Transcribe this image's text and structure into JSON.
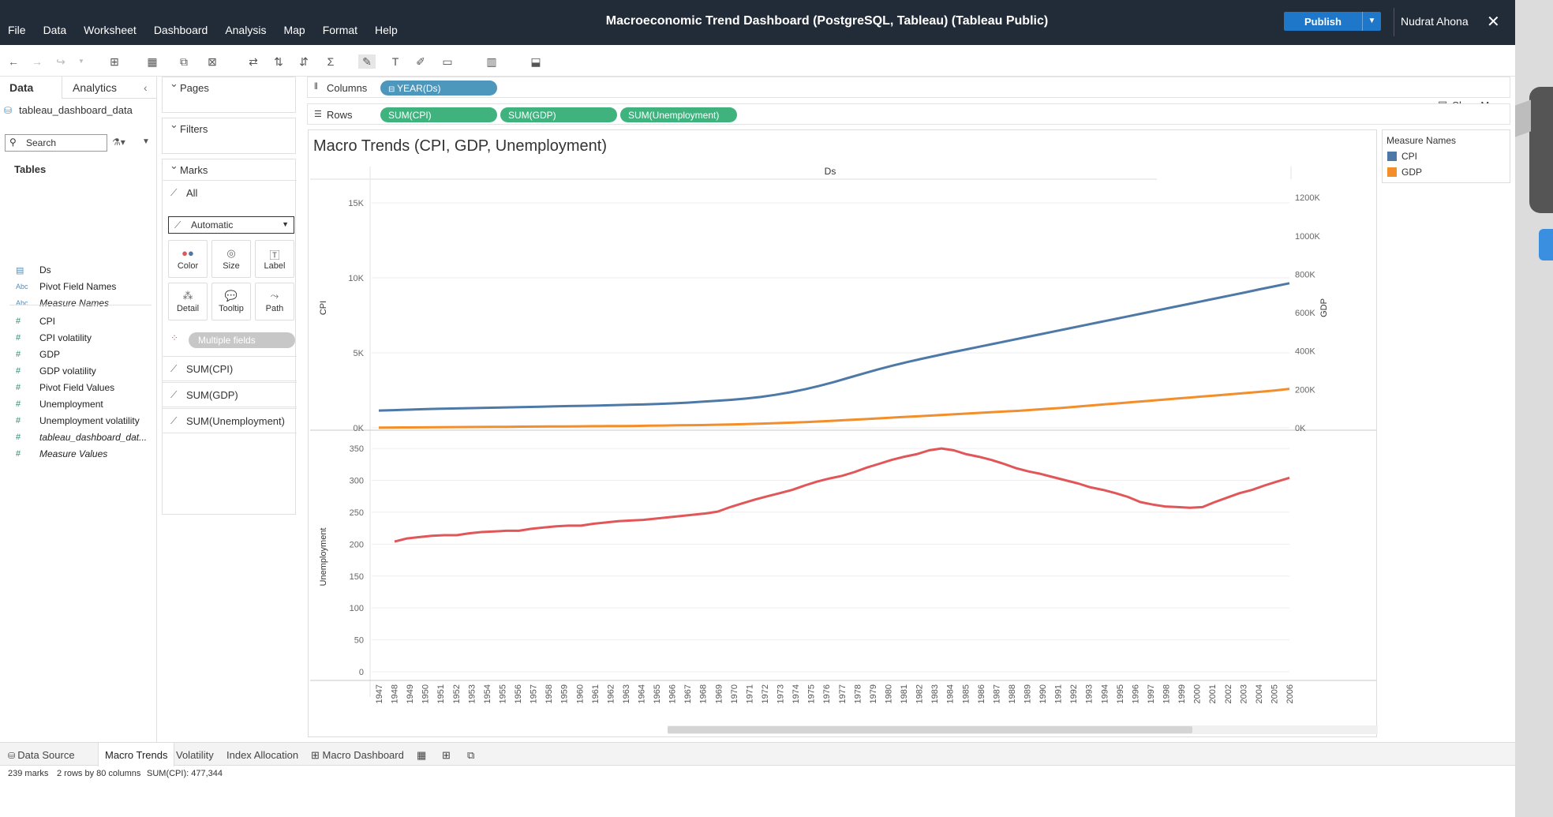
{
  "window": {
    "title": "Macroeconomic Trend Dashboard (PostgreSQL, Tableau) (Tableau Public)",
    "menu": [
      "File",
      "Data",
      "Worksheet",
      "Dashboard",
      "Analysis",
      "Map",
      "Format",
      "Help"
    ],
    "publish_label": "Publish",
    "user": "Nudrat Ahona"
  },
  "toolbar": {
    "show_me": "Show Me"
  },
  "data_pane": {
    "tabs": [
      "Data",
      "Analytics"
    ],
    "datasource": "tableau_dashboard_data",
    "search_placeholder": "Search",
    "tables_header": "Tables",
    "fields": [
      {
        "name": "Ds",
        "type": "date",
        "italic": false
      },
      {
        "name": "Pivot Field Names",
        "type": "abc",
        "italic": false
      },
      {
        "name": "Measure Names",
        "type": "abc",
        "italic": true
      },
      {
        "name": "CPI",
        "type": "num",
        "italic": false
      },
      {
        "name": "CPI volatility",
        "type": "num",
        "italic": false
      },
      {
        "name": "GDP",
        "type": "num",
        "italic": false
      },
      {
        "name": "GDP volatility",
        "type": "num",
        "italic": false
      },
      {
        "name": "Pivot Field Values",
        "type": "num",
        "italic": false
      },
      {
        "name": "Unemployment",
        "type": "num",
        "italic": false
      },
      {
        "name": "Unemployment volatility",
        "type": "num",
        "italic": false
      },
      {
        "name": "tableau_dashboard_dat...",
        "type": "num",
        "italic": true
      },
      {
        "name": "Measure Values",
        "type": "num",
        "italic": true
      }
    ]
  },
  "cards": {
    "pages": "Pages",
    "filters": "Filters",
    "marks": "Marks",
    "marks_all": "All",
    "mark_type": "Automatic",
    "buttons": [
      "Color",
      "Size",
      "Label",
      "Detail",
      "Tooltip",
      "Path"
    ],
    "multiple_fields": "Multiple fields",
    "measures": [
      "SUM(CPI)",
      "SUM(GDP)",
      "SUM(Unemployment)"
    ]
  },
  "shelves": {
    "columns_label": "Columns",
    "columns_pill": "YEAR(Ds)",
    "rows_label": "Rows",
    "rows_pills": [
      "SUM(CPI)",
      "SUM(GDP)",
      "SUM(Unemployment)"
    ]
  },
  "legend": {
    "title": "Measure Names",
    "items": [
      {
        "label": "CPI",
        "color": "#4e79a7"
      },
      {
        "label": "GDP",
        "color": "#f28e2b"
      }
    ]
  },
  "sheet_tabs": [
    "Data Source",
    "Macro Trends",
    "Volatility",
    "Index Allocation",
    "Macro Dashboard"
  ],
  "active_sheet": "Macro Trends",
  "status": {
    "marks": "239 marks",
    "dims": "2 rows by 80 columns",
    "sum": "SUM(CPI): 477,344"
  },
  "chart_data": {
    "type": "line",
    "title": "Macro Trends (CPI, GDP, Unemployment)",
    "column_header": "Ds",
    "x": [
      1947,
      1948,
      1949,
      1950,
      1951,
      1952,
      1953,
      1954,
      1955,
      1956,
      1957,
      1958,
      1959,
      1960,
      1961,
      1962,
      1963,
      1964,
      1965,
      1966,
      1967,
      1968,
      1969,
      1970,
      1971,
      1972,
      1973,
      1974,
      1975,
      1976,
      1977,
      1978,
      1979,
      1980,
      1981,
      1982,
      1983,
      1984,
      1985,
      1986,
      1987,
      1988,
      1989,
      1990,
      1991,
      1992,
      1993,
      1994,
      1995,
      1996,
      1997,
      1998,
      1999,
      2000,
      2001,
      2002,
      2003,
      2004,
      2005,
      2006
    ],
    "panes": [
      {
        "ylabel": "CPI",
        "ylim": [
          0,
          16000
        ],
        "yticks": [
          "15K",
          "10K",
          "5K",
          "0K"
        ],
        "ytick_values": [
          15000,
          10000,
          5000,
          0
        ],
        "y2label": "GDP",
        "y2lim": [
          0,
          1250000
        ],
        "y2ticks": [
          "1200K",
          "1000K",
          "800K",
          "600K",
          "400K",
          "200K",
          "0K"
        ],
        "y2tick_values": [
          1200000,
          1000000,
          800000,
          600000,
          400000,
          200000,
          0
        ],
        "series": [
          {
            "name": "CPI",
            "axis": "left",
            "color": "#4e79a7",
            "values": [
              1150,
              1180,
              1210,
              1240,
              1270,
              1290,
              1310,
              1330,
              1350,
              1370,
              1390,
              1410,
              1430,
              1450,
              1470,
              1490,
              1510,
              1535,
              1560,
              1590,
              1630,
              1680,
              1740,
              1800,
              1870,
              1950,
              2060,
              2200,
              2370,
              2570,
              2800,
              3060,
              3340,
              3620,
              3900,
              4150,
              4390,
              4610,
              4820,
              5030,
              5230,
              5430,
              5630,
              5830,
              6030,
              6230,
              6430,
              6630,
              6830,
              7030,
              7230,
              7430,
              7630,
              7830,
              8030,
              8230,
              8430,
              8630,
              8830,
              9030,
              9240,
              9440,
              9640
            ]
          },
          {
            "name": "GDP",
            "axis": "right",
            "color": "#f28e2b",
            "values": [
              1000,
              1500,
              2000,
              2500,
              3000,
              3500,
              4000,
              4500,
              5000,
              5500,
              6000,
              6500,
              7000,
              7500,
              8000,
              8500,
              9000,
              9500,
              10000,
              11000,
              12000,
              13000,
              14000,
              15000,
              16500,
              18000,
              20000,
              22000,
              24500,
              27000,
              30000,
              33500,
              37000,
              41000,
              45000,
              49000,
              53000,
              57000,
              61000,
              65000,
              69000,
              73000,
              77000,
              81000,
              85000,
              89000,
              94000,
              99000,
              104000,
              110000,
              116000,
              122000,
              128000,
              134000,
              140000,
              146000,
              152000,
              158000,
              164000,
              170000,
              176000,
              182000,
              188000,
              195000,
              203000
            ]
          }
        ]
      },
      {
        "ylabel": "Unemployment",
        "ylim": [
          0,
          360
        ],
        "yticks": [
          "350",
          "300",
          "250",
          "200",
          "150",
          "100",
          "50",
          "0"
        ],
        "ytick_values": [
          350,
          300,
          250,
          200,
          150,
          100,
          50,
          0
        ],
        "series": [
          {
            "name": "Unemployment",
            "axis": "left",
            "color": "#e15759",
            "values": [
              204,
              209,
              211,
              213,
              214,
              214,
              217,
              219,
              220,
              221,
              221,
              224,
              226,
              228,
              229,
              229,
              232,
              234,
              236,
              237,
              238,
              240,
              242,
              244,
              246,
              248,
              251,
              258,
              264,
              270,
              275,
              280,
              285,
              292,
              298,
              303,
              307,
              313,
              320,
              326,
              332,
              337,
              341,
              347,
              350,
              347,
              341,
              337,
              332,
              326,
              319,
              314,
              310,
              305,
              300,
              295,
              289,
              285,
              280,
              274,
              266,
              262,
              259,
              258,
              257,
              258,
              266,
              273,
              280,
              285,
              292,
              298,
              304
            ]
          }
        ]
      }
    ]
  }
}
